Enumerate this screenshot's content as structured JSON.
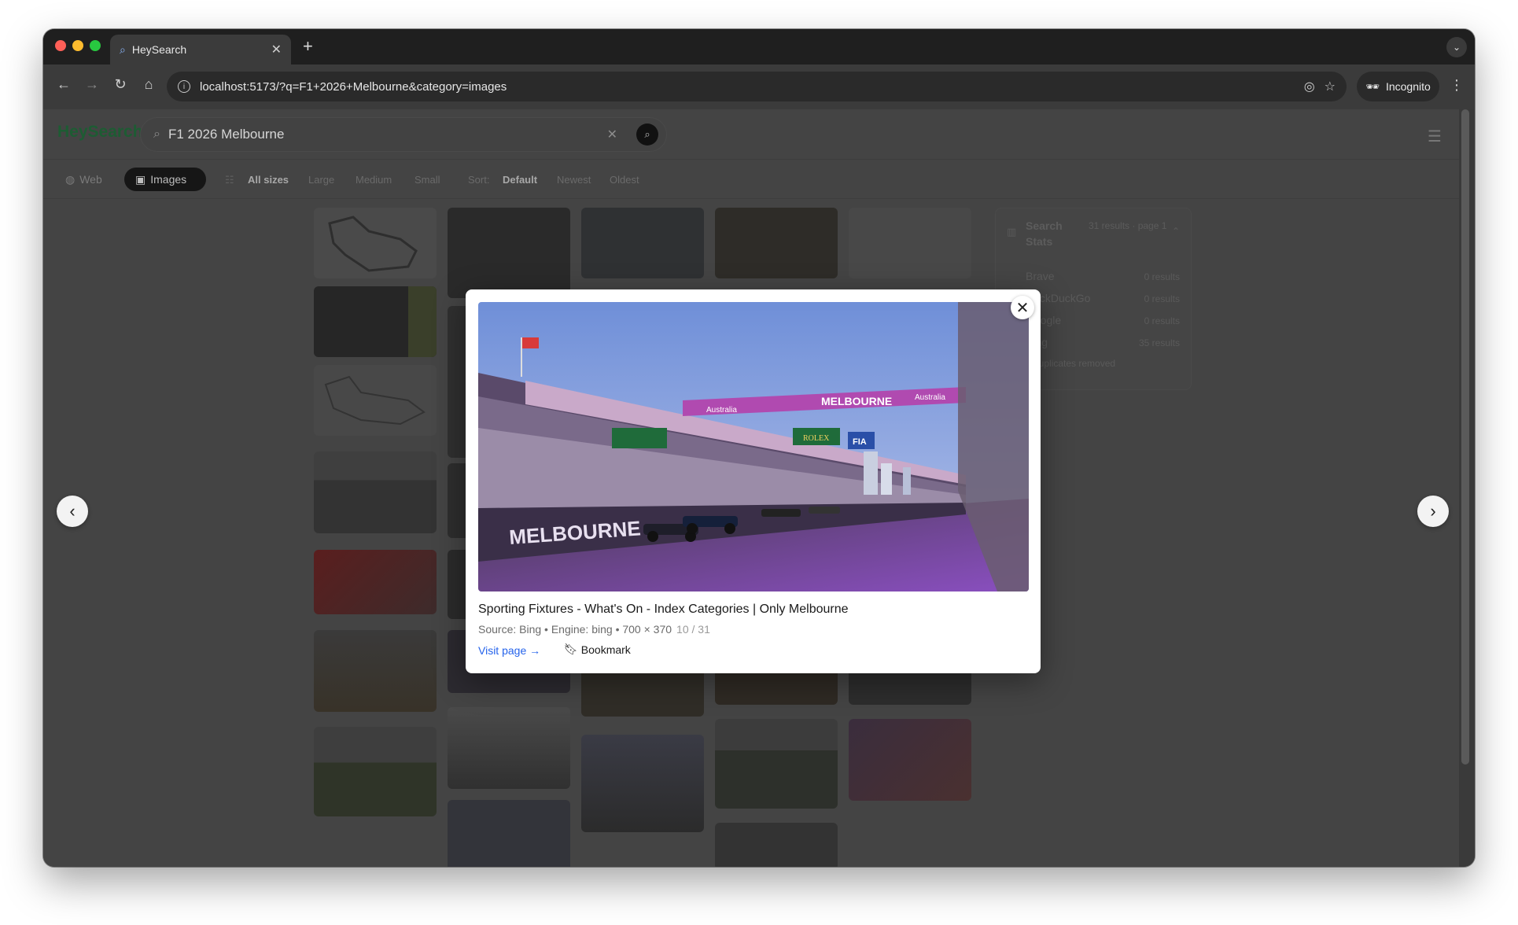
{
  "browser": {
    "tab_title": "HeySearch",
    "url": "localhost:5173/?q=F1+2026+Melbourne&category=images",
    "incognito_label": "Incognito"
  },
  "app": {
    "logo": "HeySearch",
    "query": "F1 2026 Melbourne",
    "categories": [
      {
        "label": "Web",
        "icon": "globe-icon",
        "active": false
      },
      {
        "label": "Images",
        "icon": "image-icon",
        "active": true
      }
    ],
    "size_filters": [
      "All sizes",
      "Large",
      "Medium",
      "Small"
    ],
    "sort_label": "Sort:",
    "sort_options": [
      "Default",
      "Newest",
      "Oldest"
    ]
  },
  "stats": {
    "title": "Search Stats",
    "subtitle": "31 results · page 1",
    "engines": [
      {
        "name": "Brave",
        "results": "0 results"
      },
      {
        "name": "DuckDuckGo",
        "results": "0 results"
      },
      {
        "name": "Google",
        "results": "0 results"
      },
      {
        "name": "Bing",
        "results": "35 results"
      }
    ],
    "duplicates_label": "4 duplicates removed"
  },
  "lightbox": {
    "title": "Sporting Fixtures - What's On - Index Categories | Only Melbourne",
    "meta": "Source: Bing • Engine: bing • 700 × 370",
    "counter": "10 / 31",
    "visit_label": "Visit page →",
    "bookmark_label": "Bookmark",
    "image_text": {
      "banner_left": "Australia",
      "banner_center": "MELBOURNE",
      "banner_right": "Australia",
      "wall_text": "MELBOURNE",
      "sponsor": "ROLEX",
      "fia": "FIA"
    }
  }
}
